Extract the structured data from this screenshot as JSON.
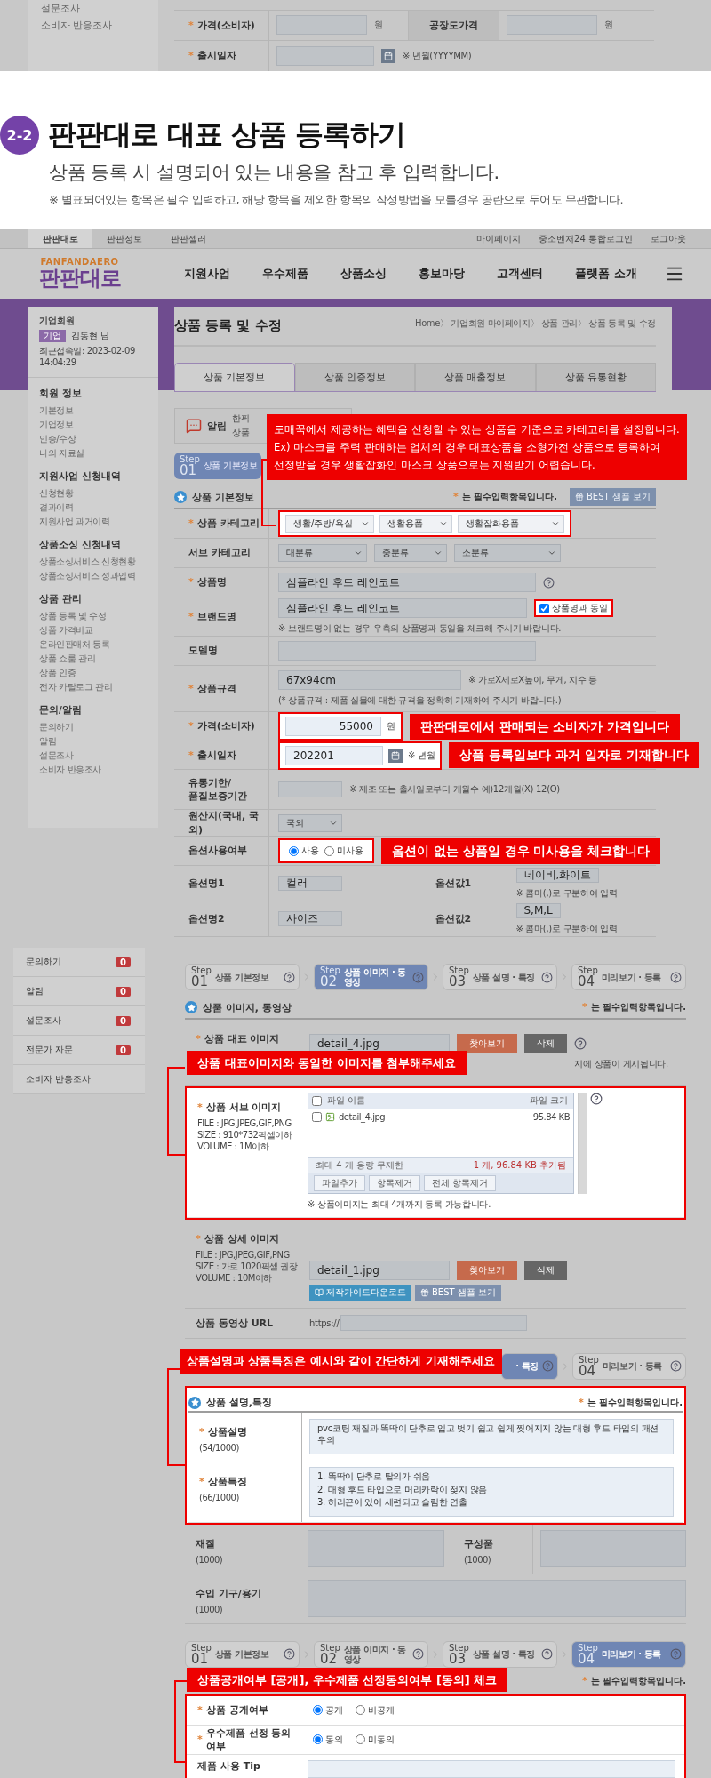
{
  "prev_strip": {
    "sidebar_items": [
      "설문조사",
      "소비자 반응조사"
    ],
    "price_row": {
      "mark": "*",
      "label": "가격(소비자)",
      "unit": "원",
      "label2": "공장도가격",
      "unit2": "원"
    },
    "date_row": {
      "mark": "*",
      "label": "출시일자",
      "hint": "※ 년월(YYYYMM)"
    }
  },
  "guide": {
    "badge": "2-2",
    "title": "판판대로 대표 상품 등록하기",
    "subtitle": "상품 등록 시 설명되어 있는 내용을 참고 후 입력합니다.",
    "note": "※ 별표되어있는 항목은 필수 입력하고, 해당 항목을 제외한 항목의 작성방법을 모를경우 공란으로 두어도 무관합니다."
  },
  "screen1": {
    "top_tabs": [
      {
        "label": "판판대로",
        "selected": true
      },
      {
        "label": "판판정보",
        "selected": false
      },
      {
        "label": "판판셀러",
        "selected": false
      }
    ],
    "top_links": [
      "마이페이지",
      "중소벤처24 통합로그인",
      "로그아웃"
    ],
    "logo": {
      "tagline": "FANFANDAERO",
      "name": "판판대로"
    },
    "menu": [
      "지원사업",
      "우수제품",
      "상품소싱",
      "홍보마당",
      "고객센터",
      "플랫폼 소개"
    ],
    "member": {
      "title": "기업회원",
      "badge": "기업",
      "name": "김동현 님",
      "last_login": "최근접속일: 2023-02-09 14:04:29"
    },
    "sidebar": [
      {
        "heading": "회원 정보",
        "items": [
          "기본정보",
          "기업정보",
          "인증/수상",
          "나의 자료실"
        ]
      },
      {
        "heading": "지원사업 신청내역",
        "items": [
          "신청현황",
          "결과이력",
          "지원사업 과거이력"
        ]
      },
      {
        "heading": "상품소싱 신청내역",
        "items": [
          "상품소싱서비스 신청현황",
          "상품소싱서비스 성과입력"
        ]
      },
      {
        "heading": "상품 관리",
        "items": [
          "상품 등록 및 수정",
          "상품 가격비교",
          "온라인판매처 등록",
          "상품 쇼룸 관리",
          "상품 인증",
          "전자 카탈로그 관리"
        ]
      },
      {
        "heading": "문의/알림",
        "items": [
          "문의하기",
          "알림",
          "설문조사",
          "소비자 반응조사"
        ]
      }
    ],
    "page_title": "상품 등록 및 수정",
    "breadcrumb": "Home〉 기업회원 마이페이지〉 상품 관리〉 상품 등록 및 수정",
    "tabs": [
      {
        "label": "상품 기본정보",
        "selected": true
      },
      {
        "label": "상품 인증정보",
        "selected": false
      },
      {
        "label": "상품 매출정보",
        "selected": false
      },
      {
        "label": "상품 유통현황",
        "selected": false
      }
    ],
    "notice": {
      "label": "알림",
      "lines": [
        "한픽",
        "상품"
      ]
    },
    "step": {
      "step": "Step",
      "num": "01",
      "label": "상품 기본정보"
    },
    "callout": [
      "도매꾹에서 제공하는 혜택을 신청할 수 있는 상품을 기준으로 카테고리를 설정합니다.",
      "Ex) 마스크를 주력 판매하는 업체의 경우 대표상품을 소형가전 상품으로 등록하여",
      "선정받을 경우 생활잡화인 마스크 상품으로는 지원받기 어렵습니다."
    ],
    "section": {
      "title": "상품 기본정보",
      "mark": "*",
      "required_note": "는 필수입력항목입니다.",
      "sample_button": "BEST 샘플 보기"
    },
    "rows": [
      {
        "kind": "selects",
        "mark": "*",
        "label": "상품 카테고리",
        "highlight": true,
        "selects": [
          "생활/주방/욕실",
          "생활용품",
          "생활잡화용품"
        ]
      },
      {
        "kind": "selects",
        "label": "서브 카테고리",
        "highlight": false,
        "selects": [
          "대분류",
          "중분류",
          "소분류"
        ]
      },
      {
        "kind": "input",
        "mark": "*",
        "label": "상품명",
        "value": "심플라인 후드 레인코트",
        "help": true
      },
      {
        "kind": "brand",
        "mark": "*",
        "label": "브랜드명",
        "value": "심플라인 후드 레인코트",
        "checkbox": {
          "label": "상품명과 동일",
          "checked": true
        },
        "note": "※ 브랜드명이 없는 경우 우측의 상품명과 동일을 체크해 주시기 바랍니다."
      },
      {
        "kind": "input",
        "label": "모델명"
      },
      {
        "kind": "spec",
        "mark": "*",
        "label": "상품규격",
        "value": "67x94cm",
        "hint": "※ 가로X세로X높이, 무게, 치수 등",
        "note": "(* 상품규격 : 제품 실물에 대한 규격을 정확히 기재하여 주시기 바랍니다.)"
      },
      {
        "kind": "price",
        "mark": "*",
        "label": "가격(소비자)",
        "value": "55000",
        "unit": "원",
        "callout": "판판대로에서 판매되는 소비자가 가격입니다"
      },
      {
        "kind": "date",
        "mark": "*",
        "label": "출시일자",
        "value": "202201",
        "hint": "※ 년월",
        "callout": "상품 등록일보다 과거 일자로 기재합니다"
      },
      {
        "kind": "period",
        "label": "유통기한/\n품질보증기간",
        "hint": "※ 제조 또는 출시일로부터 개월수 예)12개월(X) 12(O)"
      },
      {
        "kind": "select",
        "label": "원산지(국내, 국외)",
        "value": "국외"
      },
      {
        "kind": "radio",
        "label": "옵션사용여부",
        "options": [
          {
            "label": "사용",
            "selected": true
          },
          {
            "label": "미사용",
            "selected": false
          }
        ],
        "callout": "옵션이 없는 상품일 경우 미사용을 체크합니다"
      },
      {
        "kind": "pair",
        "label": "옵션명1",
        "value": "컬러",
        "label2": "옵션값1",
        "value2": "네이비,화이트",
        "note2": "※ 콤마(,)로 구분하여 입력"
      },
      {
        "kind": "pair",
        "label": "옵션명2",
        "value": "사이즈",
        "label2": "옵션값2",
        "value2": "S,M,L",
        "note2": "※ 콤마(,)로 구분하여 입력"
      }
    ]
  },
  "screen2": {
    "sidebar": [
      {
        "label": "문의하기",
        "count": "0"
      },
      {
        "label": "알림",
        "count": "0"
      },
      {
        "label": "설문조사",
        "count": "0"
      },
      {
        "label": "전문가 자문",
        "count": "0"
      },
      {
        "label": "소비자 반응조사"
      }
    ],
    "steps": [
      {
        "step": "Step",
        "num": "01",
        "label": "상품 기본정보",
        "selected": false
      },
      {
        "step": "Step",
        "num": "02",
        "label": "상품 이미지 · 동영상",
        "selected": true
      },
      {
        "step": "Step",
        "num": "03",
        "label": "상품 설명 · 특징",
        "selected": false
      },
      {
        "step": "Step",
        "num": "04",
        "label": "미리보기 · 등록",
        "selected": false
      }
    ],
    "image_section": {
      "title": "상품 이미지, 동영상",
      "mark": "*",
      "required_note": "는 필수입력항목입니다."
    },
    "main_image": {
      "mark": "*",
      "label": "상품 대표 이미지",
      "file": "detail_4.jpg",
      "browse": "찾아보기",
      "delete": "삭제",
      "note": "지에 상품이 게시됩니다."
    },
    "sub_image": {
      "callout": "상품 대표이미지와 동일한 이미지를 첨부해주세요",
      "mark": "*",
      "label": "상품 서브 이미지",
      "specs": [
        "FILE : JPG,JPEG,GIF,PNG",
        "SIZE : 910*732픽셀이하",
        "VOLUME : 1M이하"
      ],
      "header_checked": false,
      "columns": [
        "파일 이름",
        "파일 크기"
      ],
      "files": [
        {
          "name": "detail_4.jpg",
          "size": "95.84 KB",
          "checked": false
        }
      ],
      "limit": "최대 4 개 용량 무제한",
      "added": "1 개, 96.84 KB 추가됨",
      "buttons": [
        "파일추가",
        "항목제거",
        "전체 항목제거"
      ],
      "note": "※ 상품이미지는 최대 4개까지 등록 가능합니다."
    },
    "detail_image": {
      "mark": "*",
      "label": "상품 상세 이미지",
      "specs": [
        "FILE : JPG,JPEG,GIF,PNG",
        "SIZE : 가로 1020픽셀 권장",
        "VOLUME : 10M이하"
      ],
      "file": "detail_1.jpg",
      "browse": "찾아보기",
      "delete": "삭제",
      "guide_button": "제작가이드다운로드",
      "sample_button": "BEST 샘플 보기"
    },
    "video": {
      "label": "상품 동영상 URL",
      "prefix": "https://"
    },
    "mid_steps": {
      "visible_label": "· 특징",
      "last": {
        "step": "Step",
        "num": "04",
        "label": "미리보기 · 등록"
      }
    },
    "desc_section": {
      "callout": "상품설명과 상품특징은 예시와 같이 간단하게 기재해주세요",
      "title": "상품 설명,특징",
      "mark": "*",
      "required_note": "는 필수입력항목입니다.",
      "rows": [
        {
          "mark": "*",
          "label": "상품설명",
          "count": "(54/1000)",
          "lines": [
            "pvc코팅 재질과 똑딱이 단추로 입고 벗기 쉽고 쉽게 찢어지지 않는 대형 후드 타입의 패션 우의"
          ]
        },
        {
          "mark": "*",
          "label": "상품특징",
          "count": "(66/1000)",
          "lines": [
            "1. 똑딱이 단추로 탈의가 쉬움",
            "2. 대형 후드 타입으로 머리카락이 젖지 않음",
            "3. 허리끈이 있어 세련되고 슬림한 연출"
          ]
        }
      ]
    },
    "material": {
      "label": "재질",
      "count": "(1000)",
      "label2": "구성품",
      "count2": "(1000)"
    },
    "import_row": {
      "label": "수입 기구/용기",
      "count": "(1000)"
    },
    "final_steps": [
      {
        "step": "Step",
        "num": "01",
        "label": "상품 기본정보",
        "selected": false
      },
      {
        "step": "Step",
        "num": "02",
        "label": "상품 이미지 · 동영상",
        "selected": false
      },
      {
        "step": "Step",
        "num": "03",
        "label": "상품 설명 · 특징",
        "selected": false
      },
      {
        "step": "Step",
        "num": "04",
        "label": "미리보기 · 등록",
        "selected": true
      }
    ],
    "final_section": {
      "callout": "상품공개여부 [공개], 우수제품 선정동의여부 [동의] 체크",
      "mark": "*",
      "required_note": "는 필수입력항목입니다.",
      "rows": [
        {
          "mark": "*",
          "label": "상품 공개여부",
          "options": [
            {
              "label": "공개",
              "selected": true
            },
            {
              "label": "비공개",
              "selected": false
            }
          ]
        },
        {
          "mark": "*",
          "label": "우수제품 선정 동의여부",
          "options": [
            {
              "label": "동의",
              "selected": true
            },
            {
              "label": "미동의",
              "selected": false
            }
          ]
        }
      ],
      "tip_label": "제품 사용 Tip"
    }
  }
}
